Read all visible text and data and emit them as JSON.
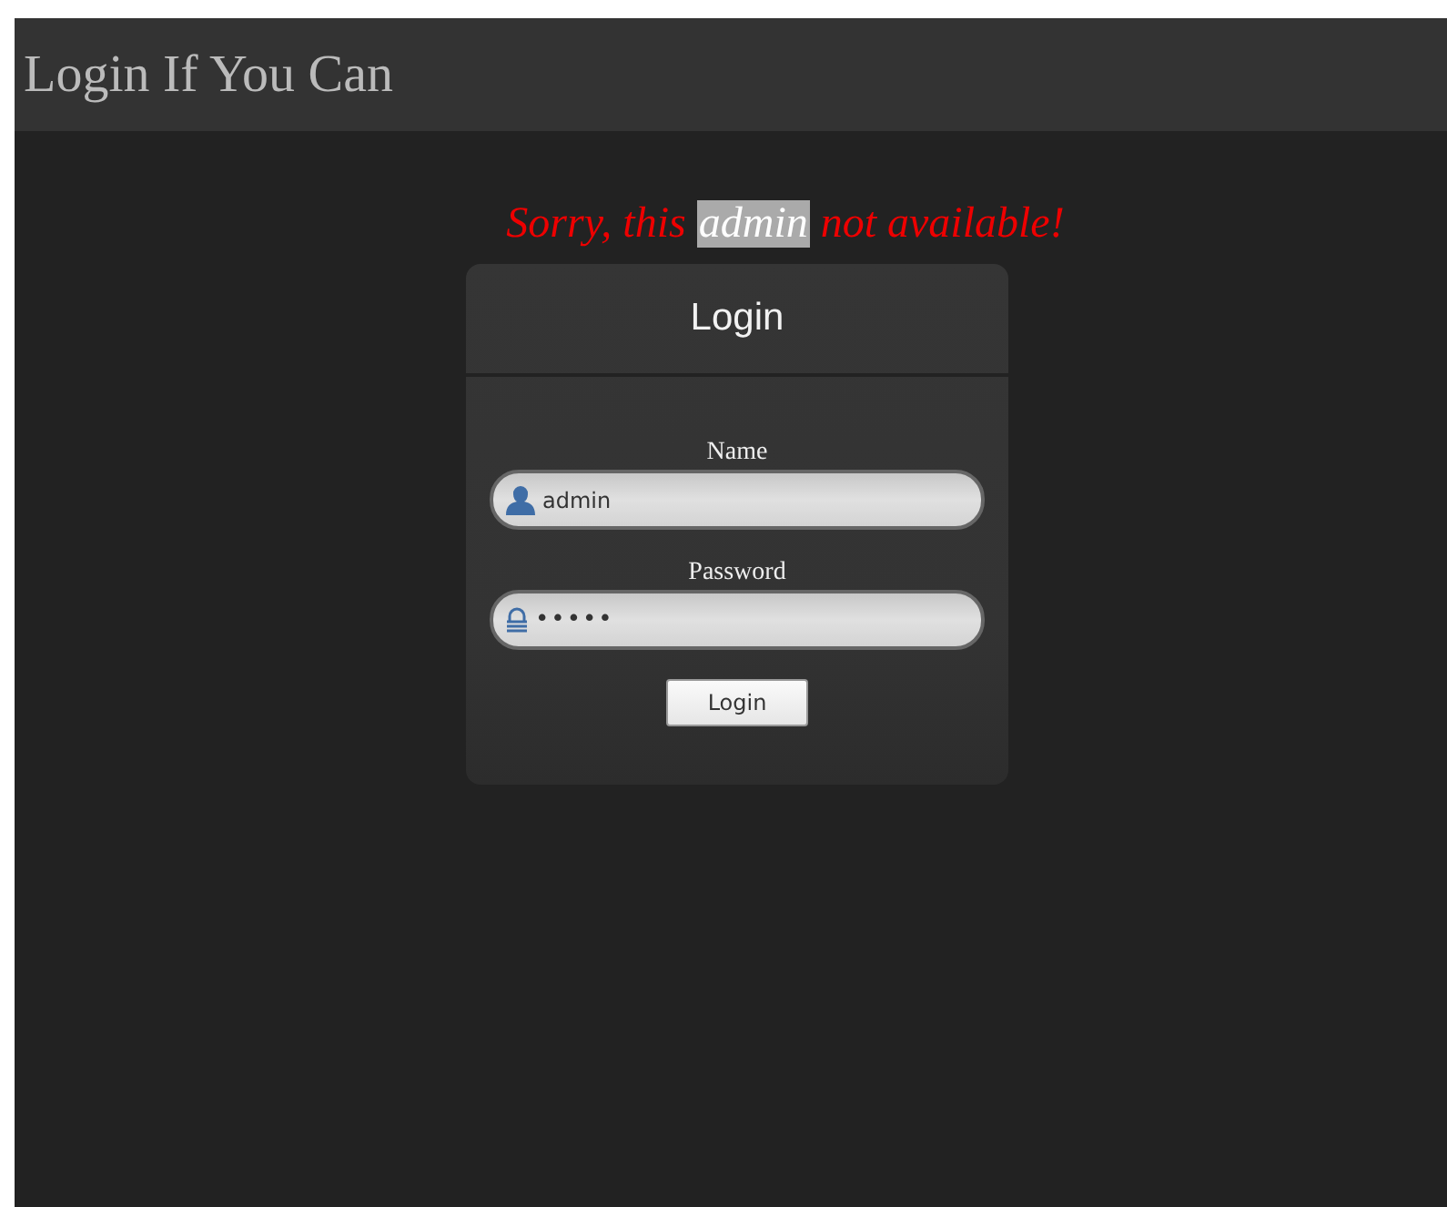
{
  "header": {
    "title": "Login If You Can"
  },
  "error": {
    "before": "Sorry, this",
    "highlight": "admin",
    "after": "not available!"
  },
  "card": {
    "title": "Login",
    "fields": [
      {
        "kind": "user",
        "label": "Name",
        "value": "admin"
      },
      {
        "kind": "password",
        "label": "Password",
        "value": "•••••"
      }
    ],
    "button": "Login"
  }
}
